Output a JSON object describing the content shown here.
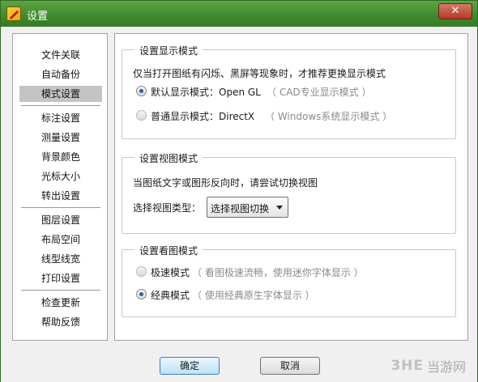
{
  "window": {
    "title": "设置",
    "close_glyph": "✕"
  },
  "sidebar": {
    "groups": [
      [
        "文件关联",
        "自动备份",
        "模式设置"
      ],
      [
        "标注设置",
        "测量设置",
        "背景颜色",
        "光标大小",
        "转出设置"
      ],
      [
        "图层设置",
        "布局空间",
        "线型线宽",
        "打印设置"
      ],
      [
        "检查更新",
        "帮助反馈"
      ]
    ],
    "selected": "模式设置"
  },
  "display_mode": {
    "title": "设置显示模式",
    "description": "仅当打开图纸有闪烁、黑屏等现象时，才推荐更换显示模式",
    "options": [
      {
        "label": "默认显示模式：Open GL",
        "hint": "（ CAD专业显示模式 ）",
        "checked": true
      },
      {
        "label": "普通显示模式：DirectX",
        "hint": "（ Windows系统显示模式 ）",
        "checked": false
      }
    ]
  },
  "view_mode": {
    "title": "设置视图模式",
    "description": "当图纸文字或图形反向时，请尝试切换视图",
    "select_label": "选择视图类型：",
    "select_value": "选择视图切换"
  },
  "browse_mode": {
    "title": "设置看图模式",
    "options": [
      {
        "label": "极速模式",
        "hint": "（ 看图极速流畅，使用迷你字体显示 ）",
        "checked": false
      },
      {
        "label": "经典模式",
        "hint": "（ 使用经典原生字体显示 ）",
        "checked": true
      }
    ]
  },
  "buttons": {
    "ok": "确定",
    "cancel": "取消"
  },
  "watermark": {
    "logo": "3HE",
    "text": "当游网"
  },
  "colors": {
    "titlebar": "#3e8a2c",
    "selected_item": "#c4c4c4",
    "radio_dot": "#2a5ea8",
    "hint": "#8a8a8a"
  },
  "icons": {
    "app": "app-logo-icon",
    "close": "close-icon",
    "dropdown": "chevron-down-icon"
  }
}
